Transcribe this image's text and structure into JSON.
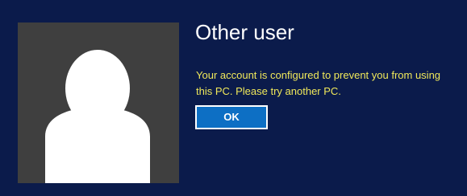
{
  "user": {
    "name": "Other user",
    "avatar_icon": "default-user-silhouette-icon"
  },
  "dialog": {
    "message": "Your account is configured to prevent you from using this PC. Please try another PC.",
    "ok_label": "OK"
  },
  "colors": {
    "background": "#0b1b4b",
    "avatar_tile": "#3f3f3f",
    "message_text": "#f0e85a",
    "button": "#0d6fc4"
  }
}
